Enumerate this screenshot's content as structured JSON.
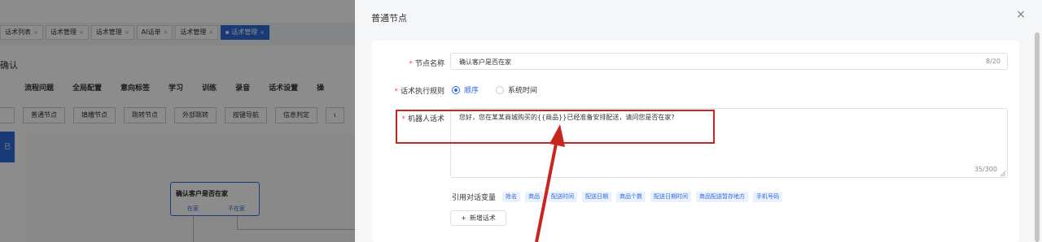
{
  "background": {
    "tabs": [
      {
        "label": "话术列表"
      },
      {
        "label": "话术管理"
      },
      {
        "label": "话术管理"
      },
      {
        "label": "AI话单"
      },
      {
        "label": "话术管理"
      },
      {
        "label": "话术管理",
        "active": true
      }
    ],
    "tab_close_glyph": "×",
    "page_title": "确认",
    "menu": [
      "流程问题",
      "全局配置",
      "意向标签",
      "学习",
      "训练",
      "录音",
      "话术设置",
      "操"
    ],
    "node_types": [
      "普通节点",
      "填槽节点",
      "跳转节点",
      "外部跳转",
      "按键导航",
      "信息判定",
      "ι"
    ],
    "side_button": "已",
    "canvas_node": {
      "title": "确认客户是否在家",
      "branches": [
        "在家",
        "不在家"
      ]
    }
  },
  "drawer": {
    "title": "普通节点",
    "close_icon": "close-icon",
    "form": {
      "node_name": {
        "label": "节点名称",
        "value": "确认客户是否在家",
        "counter": "8/20"
      },
      "exec_rule": {
        "label": "话术执行规则",
        "options": [
          {
            "label": "顺序",
            "selected": true
          },
          {
            "label": "系统时间",
            "selected": false
          }
        ]
      },
      "robot_script": {
        "label": "机器人话术",
        "value": "您好，您在某某商城购买的{{商品}}已经准备安排配送，请问您是否在家?",
        "counter": "35/300"
      },
      "variables": {
        "label": "引用对话变量",
        "items": [
          "姓名",
          "商品",
          "配送时间",
          "配送日期",
          "商品个数",
          "配送日期时间",
          "商品配送暂存地方",
          "手机号码"
        ]
      },
      "add_button": "新增话术",
      "add_glyph": "+"
    }
  },
  "required_mark": "*",
  "colors": {
    "accent": "#2f6bd8",
    "required": "#f04b4b",
    "annotation": "#c9251f"
  }
}
